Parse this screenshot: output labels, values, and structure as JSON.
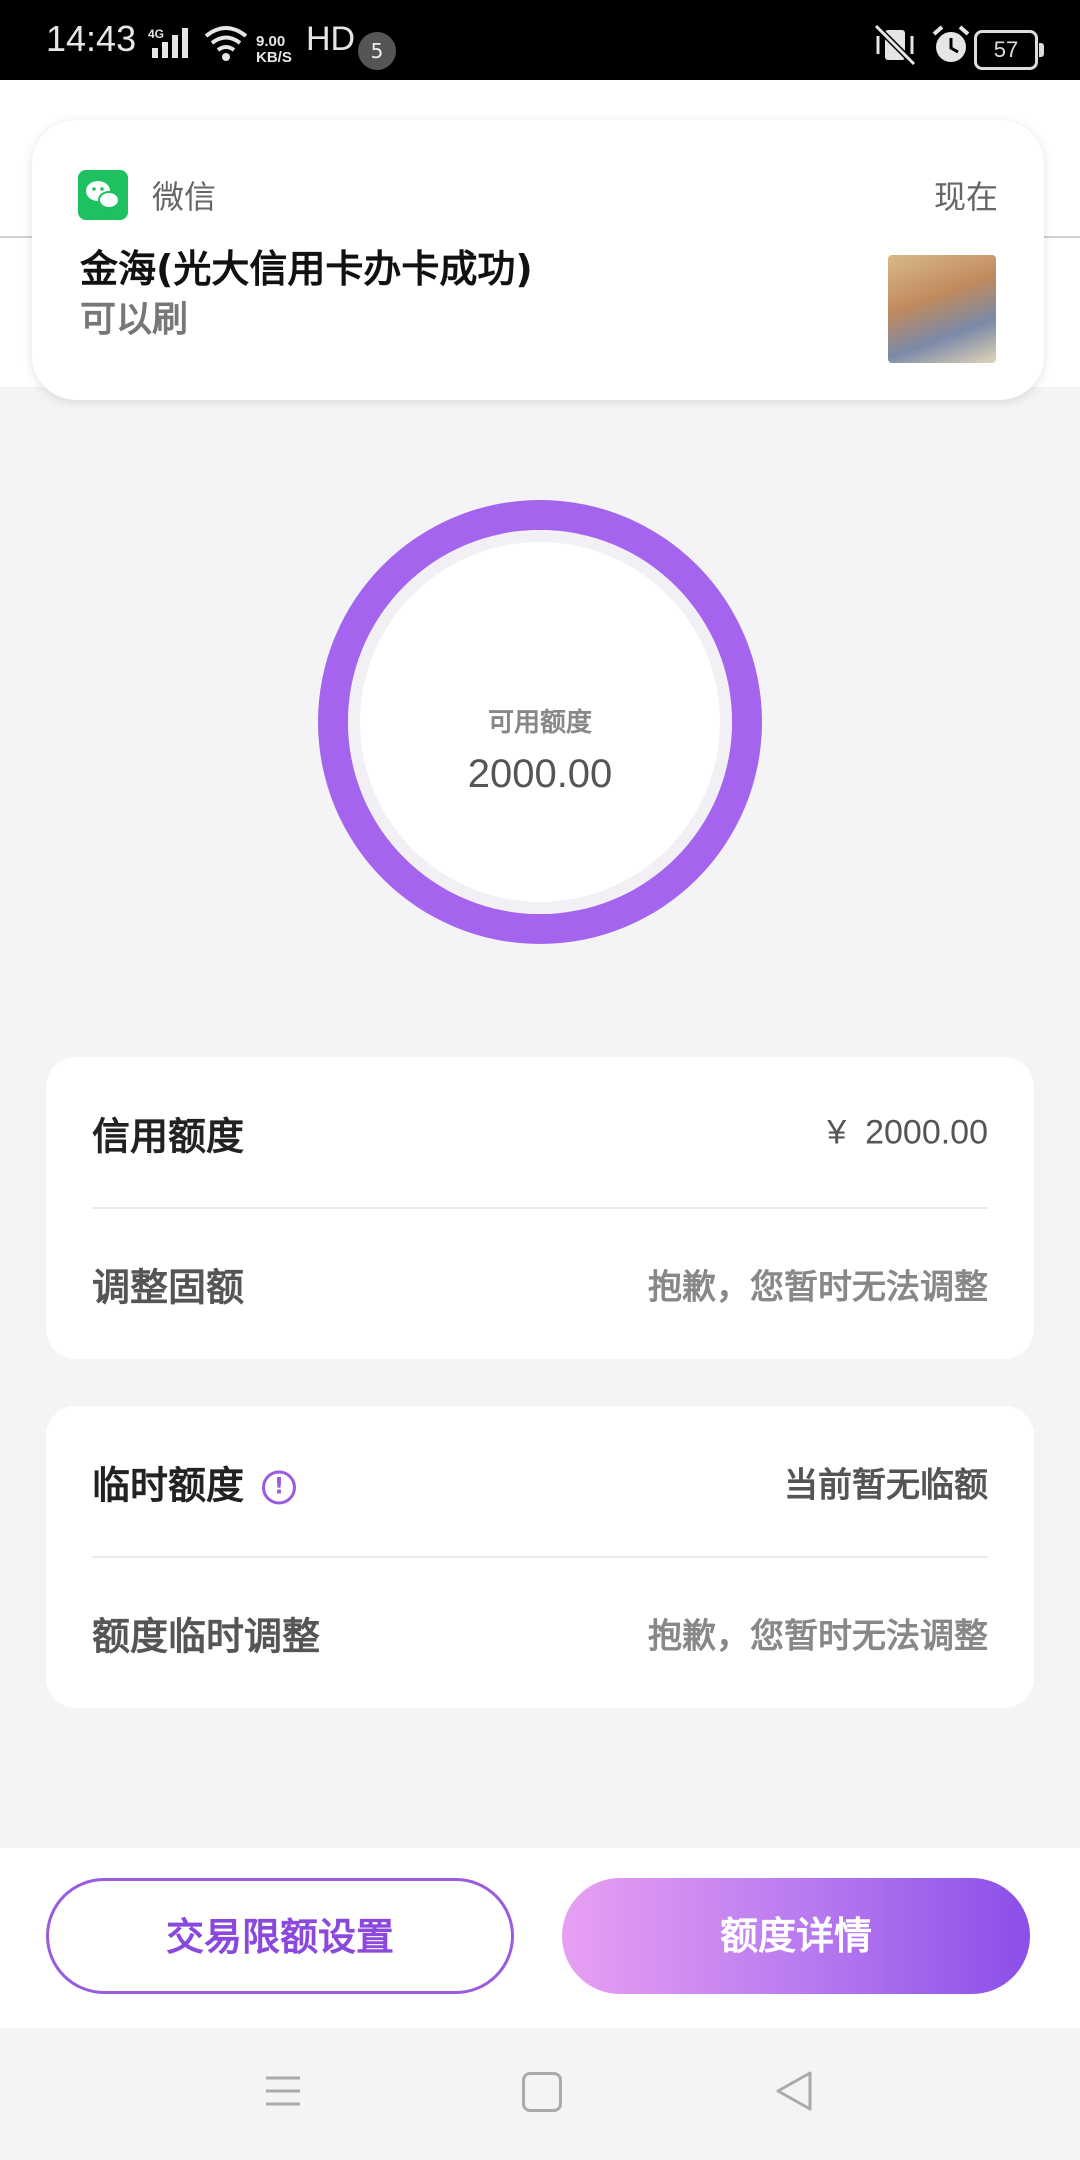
{
  "status_bar": {
    "time": "14:43",
    "network": "4G",
    "speed_value": "9.00",
    "speed_unit": "KB/S",
    "hd": "HD",
    "notification_count": "5",
    "battery": "57"
  },
  "notification": {
    "app_name": "微信",
    "time": "现在",
    "title": "金海(光大信用卡办卡成功)",
    "body": "可以刷",
    "app_icon": "wechat-icon"
  },
  "ring": {
    "label": "可用额度",
    "value": "2000.00",
    "accent_color": "#a464ee"
  },
  "credit_card": {
    "limit_label": "信用额度",
    "limit_currency": "¥",
    "limit_value": "2000.00",
    "adjust_label": "调整固额",
    "adjust_value": "抱歉，您暂时无法调整"
  },
  "temp_card": {
    "temp_label": "临时额度",
    "temp_value": "当前暂无临额",
    "temp_adjust_label": "额度临时调整",
    "temp_adjust_value": "抱歉，您暂时无法调整"
  },
  "buttons": {
    "limit_settings": "交易限额设置",
    "limit_details": "额度详情"
  },
  "nav": {
    "menu": "menu-icon",
    "home": "home-icon",
    "back": "back-icon"
  }
}
